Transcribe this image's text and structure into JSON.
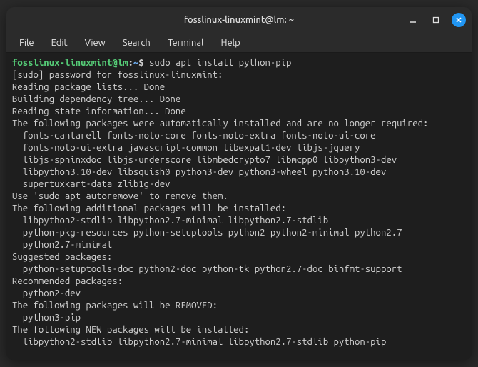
{
  "titlebar": {
    "title": "fosslinux-linuxmint@lm: ~"
  },
  "menubar": {
    "file": "File",
    "edit": "Edit",
    "view": "View",
    "search": "Search",
    "terminal": "Terminal",
    "help": "Help"
  },
  "prompt": {
    "userhost": "fosslinux-linuxmint@lm",
    "sep1": ":",
    "path": "~",
    "sep2": "$ "
  },
  "command": "sudo apt install python-pip",
  "output": {
    "l1": "[sudo] password for fosslinux-linuxmint:",
    "l2": "Reading package lists... Done",
    "l3": "Building dependency tree... Done",
    "l4": "Reading state information... Done",
    "l5": "The following packages were automatically installed and are no longer required:",
    "l6": "  fonts-cantarell fonts-noto-core fonts-noto-extra fonts-noto-ui-core",
    "l7": "  fonts-noto-ui-extra javascript-common libexpat1-dev libjs-jquery",
    "l8": "  libjs-sphinxdoc libjs-underscore libmbedcrypto7 libmcpp0 libpython3-dev",
    "l9": "  libpython3.10-dev libsquish0 python3-dev python3-wheel python3.10-dev",
    "l10": "  supertuxkart-data zlib1g-dev",
    "l11": "Use 'sudo apt autoremove' to remove them.",
    "l12": "The following additional packages will be installed:",
    "l13": "  libpython2-stdlib libpython2.7-minimal libpython2.7-stdlib",
    "l14": "  python-pkg-resources python-setuptools python2 python2-minimal python2.7",
    "l15": "  python2.7-minimal",
    "l16": "Suggested packages:",
    "l17": "  python-setuptools-doc python2-doc python-tk python2.7-doc binfmt-support",
    "l18": "Recommended packages:",
    "l19": "  python2-dev",
    "l20": "The following packages will be REMOVED:",
    "l21": "  python3-pip",
    "l22": "The following NEW packages will be installed:",
    "l23": "  libpython2-stdlib libpython2.7-minimal libpython2.7-stdlib python-pip"
  }
}
